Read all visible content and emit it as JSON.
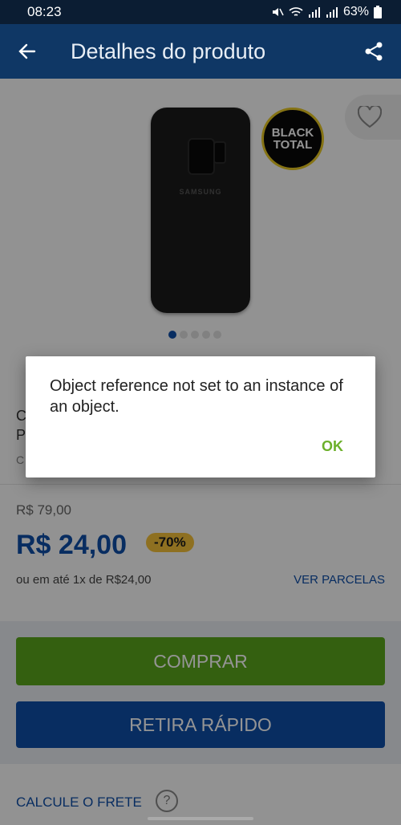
{
  "status_bar": {
    "time": "08:23",
    "battery": "63%"
  },
  "app_bar": {
    "title": "Detalhes do produto"
  },
  "product": {
    "brand_on_case": "SAMSUNG",
    "badge_line1": "BLACK",
    "badge_line2": "TOTAL",
    "title_line1": "C",
    "title_line2": "P",
    "subtitle": "C",
    "carousel_count": 5,
    "carousel_active": 0
  },
  "price": {
    "old": "R$ 79,00",
    "current": "R$ 24,00",
    "discount": "-70%",
    "installments": "ou em até 1x de R$24,00",
    "ver_parcelas": "VER PARCELAS"
  },
  "actions": {
    "buy_label": "COMPRAR",
    "pickup_label": "RETIRA RÁPIDO",
    "shipping_label": "CALCULE O FRETE",
    "help_symbol": "?"
  },
  "dialog": {
    "message": "Object reference not set to an instance of an object.",
    "ok_label": "OK"
  },
  "colors": {
    "app_bar": "#0f3765",
    "primary_blue": "#0f4ea8",
    "buy_green": "#5aa51c",
    "discount_yellow": "#f5c13a",
    "dialog_ok": "#6cb02a"
  },
  "icons": [
    "back-arrow-icon",
    "share-icon",
    "heart-icon",
    "help-icon",
    "wifi-icon",
    "signal-icon",
    "battery-icon",
    "mute-icon"
  ]
}
